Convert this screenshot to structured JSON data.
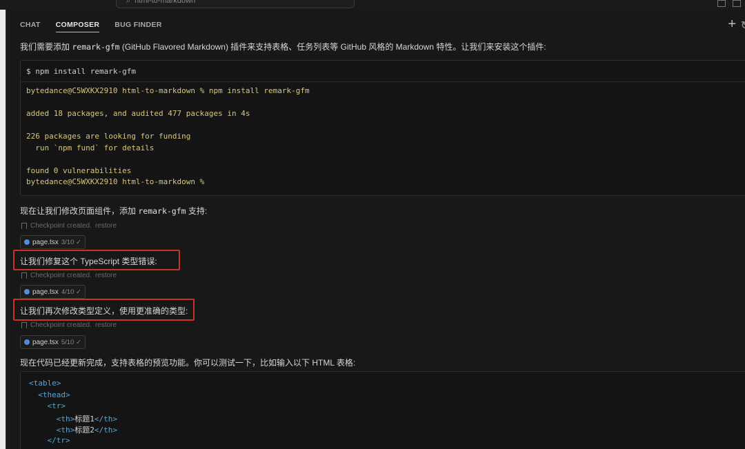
{
  "titlebar": {
    "search_text": "html-to-markdown"
  },
  "tabs": [
    {
      "label": "CHAT"
    },
    {
      "label": "COMPOSER"
    },
    {
      "label": "BUG FINDER"
    }
  ],
  "icons": {
    "new_chat": "plus-icon",
    "search": "search-icon",
    "checkpoint": "bookmark-icon",
    "file": "react-file-icon"
  },
  "messages": {
    "intro_pre": "我们需要添加 ",
    "intro_code": "remark-gfm",
    "intro_post": " (GitHub Flavored Markdown) 插件来支持表格、任务列表等 GitHub 风格的 Markdown 特性。让我们来安装这个插件:",
    "command": "$ npm install remark-gfm",
    "terminal": [
      "bytedance@C5WXKX2910 html-to-markdown % npm install remark-gfm",
      "",
      "added 18 packages, and audited 477 packages in 4s",
      "",
      "226 packages are looking for funding",
      "  run `npm fund` for details",
      "",
      "found 0 vulnerabilities",
      "bytedance@C5WXKX2910 html-to-markdown %"
    ],
    "step2_pre": "现在让我们修改页面组件，添加 ",
    "step2_code": "remark-gfm",
    "step2_post": " 支持:",
    "checkpoint_text": "Checkpoint created.",
    "restore_text": "restore",
    "chip1_file": "page.tsx",
    "chip1_meta": "3/10 ✓",
    "fix1": "让我们修复这个 TypeScript 类型错误:",
    "chip2_file": "page.tsx",
    "chip2_meta": "4/10 ✓",
    "fix2": "让我们再次修改类型定义，使用更准确的类型:",
    "chip3_file": "page.tsx",
    "chip3_meta": "5/10 ✓",
    "final": "现在代码已经更新完成，支持表格的预览功能。你可以测试一下，比如输入以下 HTML 表格:"
  },
  "html_example": {
    "lines": [
      {
        "open": "<table>",
        "text": "",
        "close": ""
      },
      {
        "open": "  <thead>",
        "text": "",
        "close": ""
      },
      {
        "open": "    <tr>",
        "text": "",
        "close": ""
      },
      {
        "open": "      <th>",
        "text": "标题1",
        "close": "</th>"
      },
      {
        "open": "      <th>",
        "text": "标题2",
        "close": "</th>"
      },
      {
        "open": "    </tr>",
        "text": "",
        "close": ""
      }
    ]
  },
  "colors": {
    "highlight_border": "#d0302a",
    "terminal_text": "#d9c77a",
    "tag_color": "#5aa7d6"
  }
}
